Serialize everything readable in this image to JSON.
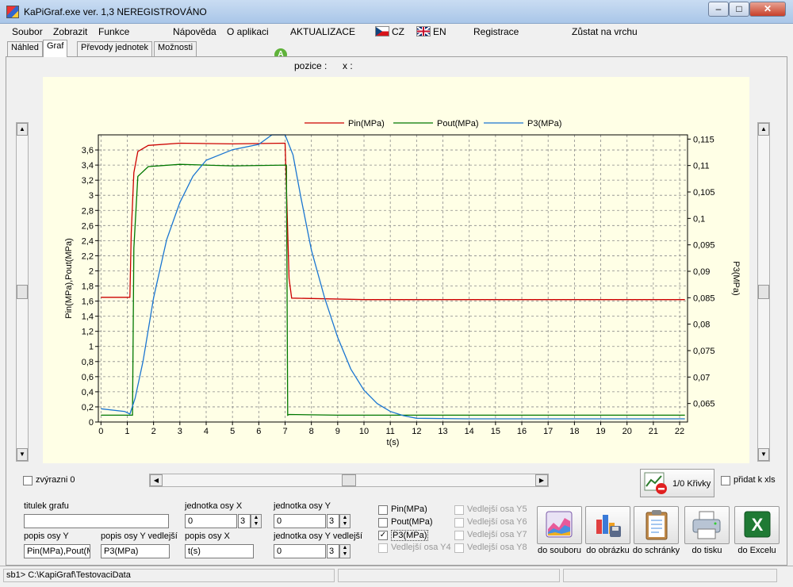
{
  "window": {
    "title": "KaPiGraf.exe   ver. 1,3   NEREGISTROVÁNO",
    "min": "–",
    "max": "□",
    "close": "✕"
  },
  "menu": {
    "soubor": "Soubor",
    "zobrazit": "Zobrazit",
    "funkce": "Funkce",
    "napoveda": "Nápověda",
    "o_aplikaci": "O aplikaci",
    "aktualizace": "AKTUALIZACE",
    "cz": "CZ",
    "en": "EN",
    "registrace": "Registrace",
    "zustat": "Zůstat na vrchu"
  },
  "tabs": [
    "Náhled",
    "Graf",
    "Převody jednotek",
    "Možnosti"
  ],
  "position": {
    "label": "pozice :",
    "x_label": "x :"
  },
  "chart_data": {
    "type": "line",
    "x": {
      "label": "t(s)",
      "ticks": [
        0,
        1,
        2,
        3,
        4,
        5,
        6,
        7,
        8,
        9,
        10,
        11,
        12,
        13,
        14,
        15,
        16,
        17,
        18,
        19,
        20,
        21,
        22
      ],
      "range": [
        -0.1,
        22.3
      ]
    },
    "y_left": {
      "label": "Pin(MPa),Pout(MPa)",
      "range": [
        0,
        3.8
      ],
      "ticks": [
        "0",
        "0,2",
        "0,4",
        "0,6",
        "0,8",
        "1",
        "1,2",
        "1,4",
        "1,6",
        "1,8",
        "2",
        "2,2",
        "2,4",
        "2,6",
        "2,8",
        "3",
        "3,2",
        "3,4",
        "3,6"
      ]
    },
    "y_right": {
      "label": "P3(MPa)",
      "range": [
        0.0615,
        0.1158
      ],
      "ticks": [
        "0,065",
        "0,07",
        "0,075",
        "0,08",
        "0,085",
        "0,09",
        "0,095",
        "0,1",
        "0,105",
        "0,11",
        "0,115"
      ]
    },
    "grid": true,
    "legend_position": "top",
    "series": [
      {
        "name": "Pin(MPa)",
        "color": "#cc0000",
        "axis": "left",
        "points": [
          [
            0,
            1.65
          ],
          [
            1.1,
            1.65
          ],
          [
            1.15,
            2.5
          ],
          [
            1.25,
            3.3
          ],
          [
            1.4,
            3.58
          ],
          [
            1.8,
            3.66
          ],
          [
            3,
            3.69
          ],
          [
            5,
            3.68
          ],
          [
            7.0,
            3.69
          ],
          [
            7.05,
            3.1
          ],
          [
            7.15,
            1.9
          ],
          [
            7.25,
            1.64
          ],
          [
            10,
            1.62
          ],
          [
            22.2,
            1.62
          ]
        ]
      },
      {
        "name": "Pout(MPa)",
        "color": "#007700",
        "axis": "left",
        "points": [
          [
            0,
            0.09
          ],
          [
            1.2,
            0.09
          ],
          [
            1.25,
            2.3
          ],
          [
            1.4,
            3.25
          ],
          [
            1.8,
            3.38
          ],
          [
            3,
            3.41
          ],
          [
            5,
            3.39
          ],
          [
            7.05,
            3.4
          ],
          [
            7.1,
            0.09
          ],
          [
            7.15,
            0.1
          ],
          [
            9,
            0.09
          ],
          [
            22.2,
            0.09
          ]
        ]
      },
      {
        "name": "P3(MPa)",
        "color": "#1a75d1",
        "axis": "right",
        "points": [
          [
            0,
            0.064
          ],
          [
            0.9,
            0.0635
          ],
          [
            1.1,
            0.063
          ],
          [
            1.3,
            0.066
          ],
          [
            1.6,
            0.073
          ],
          [
            2,
            0.085
          ],
          [
            2.5,
            0.096
          ],
          [
            3,
            0.103
          ],
          [
            3.5,
            0.108
          ],
          [
            4,
            0.111
          ],
          [
            5,
            0.113
          ],
          [
            6,
            0.114
          ],
          [
            6.5,
            0.1158
          ],
          [
            7.0,
            0.1158
          ],
          [
            7.3,
            0.112
          ],
          [
            7.6,
            0.104
          ],
          [
            8,
            0.094
          ],
          [
            8.5,
            0.085
          ],
          [
            9,
            0.0775
          ],
          [
            9.5,
            0.0715
          ],
          [
            10,
            0.0675
          ],
          [
            10.5,
            0.065
          ],
          [
            11,
            0.0635
          ],
          [
            11.5,
            0.0627
          ],
          [
            12,
            0.0622
          ],
          [
            14,
            0.0621
          ],
          [
            22.2,
            0.0621
          ]
        ]
      }
    ]
  },
  "controls": {
    "zvyrazni": "zvýrazni 0",
    "krivky": "1/0 Křivky",
    "pridat_xls": "přidat k xls",
    "titulek_grafu": "titulek grafu",
    "titulek_value": "",
    "popis_osy_y": "popis osy Y",
    "popis_osy_y_value": "Pin(MPa),Pout(MPa)",
    "popis_osy_y_vedlejsi": "popis osy Y vedlejší",
    "popis_osy_y_vedlejsi_value": "P3(MPa)",
    "jednotka_osy_x": "jednotka osy X",
    "jednotka_osy_x_value": "0",
    "jednotka_osy_x_dec": "3",
    "popis_osy_x": "popis osy X",
    "popis_osy_x_value": "t(s)",
    "jednotka_osy_y": "jednotka osy Y",
    "jednotka_osy_y_value": "0",
    "jednotka_osy_y_dec": "3",
    "jednotka_osy_y_vedlejsi": "jednotka osy Y vedlejší",
    "jednotka_osy_y_vedlejsi_value": "0",
    "jednotka_osy_y_vedlejsi_dec": "3",
    "series_checks": [
      {
        "label": "Pin(MPa)",
        "checked": false,
        "enabled": true
      },
      {
        "label": "Pout(MPa)",
        "checked": false,
        "enabled": true
      },
      {
        "label": "P3(MPa)",
        "checked": true,
        "enabled": true
      },
      {
        "label": "Vedlejší osa Y4",
        "checked": false,
        "enabled": false
      }
    ],
    "vedlejsi_checks": [
      {
        "label": "Vedlejší osa Y5"
      },
      {
        "label": "Vedlejší osa Y6"
      },
      {
        "label": "Vedlejší osa Y7"
      },
      {
        "label": "Vedlejší osa Y8"
      }
    ],
    "export_buttons": [
      "do souboru",
      "do obrázku",
      "do schránky",
      "do tisku",
      "do Excelu"
    ]
  },
  "status": {
    "path": "sb1> C:\\KapiGraf\\TestovaciData"
  }
}
